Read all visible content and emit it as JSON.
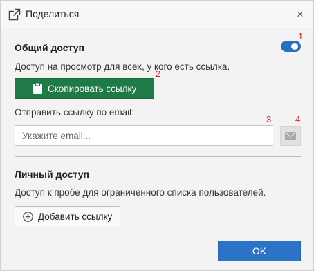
{
  "dialog": {
    "title": "Поделиться",
    "title_icon": "share-external-icon",
    "close_glyph": "×"
  },
  "public_access": {
    "title": "Общий доступ",
    "description": "Доступ на просмотр для всех, у кого есть ссылка.",
    "toggle_on": true,
    "copy_button_label": "Скопировать ссылку",
    "copy_button_icon": "clipboard-icon",
    "email_label": "Отправить ссылку по email:",
    "email_placeholder": "Укажите email...",
    "email_value": "",
    "send_icon": "envelope-icon"
  },
  "private_access": {
    "title": "Личный доступ",
    "description": "Доступ к пробе для ограниченного списка пользователей.",
    "add_link_label": "Добавить ссылку",
    "add_link_icon": "plus-circle-icon"
  },
  "footer": {
    "ok_label": "OK"
  },
  "annotations": {
    "m1": "1",
    "m2": "2",
    "m3": "3",
    "m4": "4"
  },
  "colors": {
    "accent_blue": "#2a73c6",
    "copy_green": "#1e7a46",
    "marker_red": "#e02020"
  }
}
